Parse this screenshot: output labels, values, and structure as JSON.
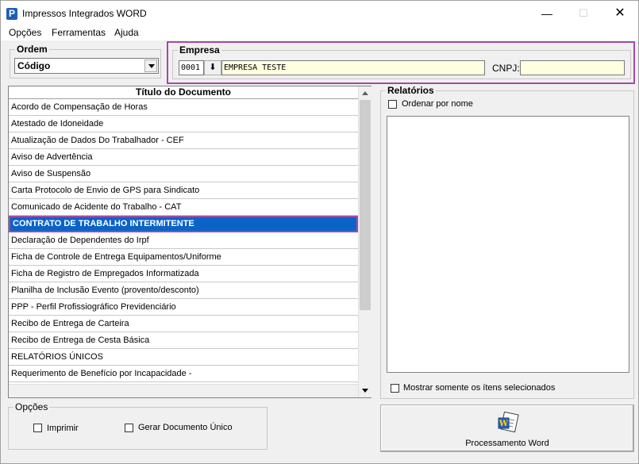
{
  "window": {
    "title": "Impressos Integrados WORD",
    "app_icon_letter": "P",
    "minimize": "—",
    "maximize": "☐",
    "close": "✕"
  },
  "menu": [
    "Opções",
    "Ferramentas",
    "Ajuda"
  ],
  "ordem": {
    "label": "Ordem",
    "selected": "Código"
  },
  "empresa": {
    "label": "Empresa",
    "code": "0001",
    "lookup_button": "⬇",
    "name": "EMPRESA TESTE",
    "cnpj_label": "CNPJ:",
    "cnpj_value": ""
  },
  "documentos": {
    "header": "Título do Documento",
    "rows": [
      "Acordo de Compensação de Horas",
      "Atestado de Idoneidade",
      "Atualização de Dados Do Trabalhador - CEF",
      "Aviso de Advertência",
      "Aviso de Suspensão",
      "Carta Protocolo de Envio de GPS para Sindicato",
      "Comunicado de Acidente do Trabalho - CAT",
      "CONTRATO DE TRABALHO INTERMITENTE",
      "Declaração de Dependentes do Irpf",
      "Ficha de Controle de Entrega Equipamentos/Uniforme",
      "Ficha de Registro de Empregados Informatizada",
      "Planilha de Inclusão Evento (provento/desconto)",
      "PPP - Perfil Profissiográfico Previdenciário",
      "Recibo de Entrega de Carteira",
      "Recibo de Entrega de Cesta Básica",
      "RELATÓRIOS ÚNICOS",
      "Requerimento de Benefício por Incapacidade -"
    ],
    "selected_row": "CONTRATO DE TRABALHO INTERMITENTE"
  },
  "relatorios": {
    "label": "Relatórios",
    "ordenar_por_nome": "Ordenar por nome",
    "mostrar_somente": "Mostrar somente os ítens selecionados"
  },
  "opcoes": {
    "label": "Opções",
    "imprimir": "Imprimir",
    "gerar_documento_unico": "Gerar Documento Único"
  },
  "processamento": {
    "label": "Processamento Word",
    "icon": "word-document-icon"
  },
  "colors": {
    "selection": "#0a64c8",
    "highlight_border": "#a24aa8",
    "field_yellow": "#ffffe1",
    "app_icon": "#1e5fb4"
  }
}
